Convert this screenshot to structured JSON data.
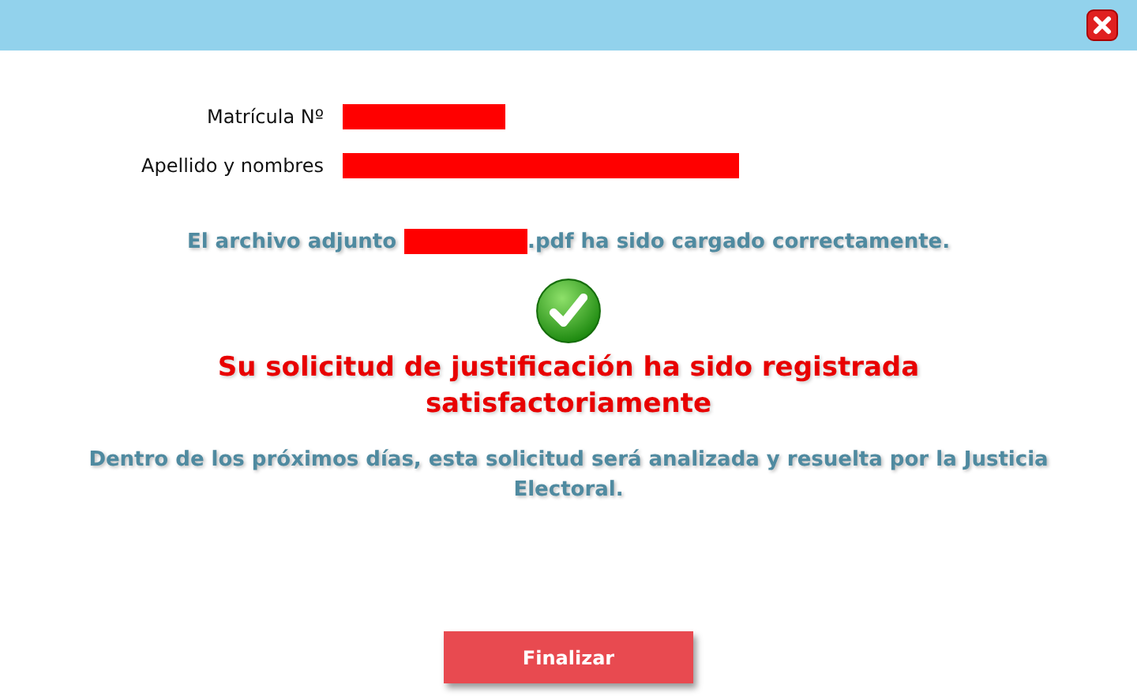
{
  "fields": [
    {
      "label": "Matrícula Nº"
    },
    {
      "label": "Apellido y nombres"
    }
  ],
  "upload_message": {
    "before": "El archivo adjunto",
    "after": ".pdf ha sido cargado correctamente."
  },
  "success_title": "Su solicitud de justificación ha sido registrada satisfactoriamente",
  "info_message": "Dentro de los próximos días, esta solicitud será analizada y resuelta por la Justicia Electoral.",
  "buttons": [
    {
      "label": "Finalizar",
      "kind": "primary"
    }
  ]
}
